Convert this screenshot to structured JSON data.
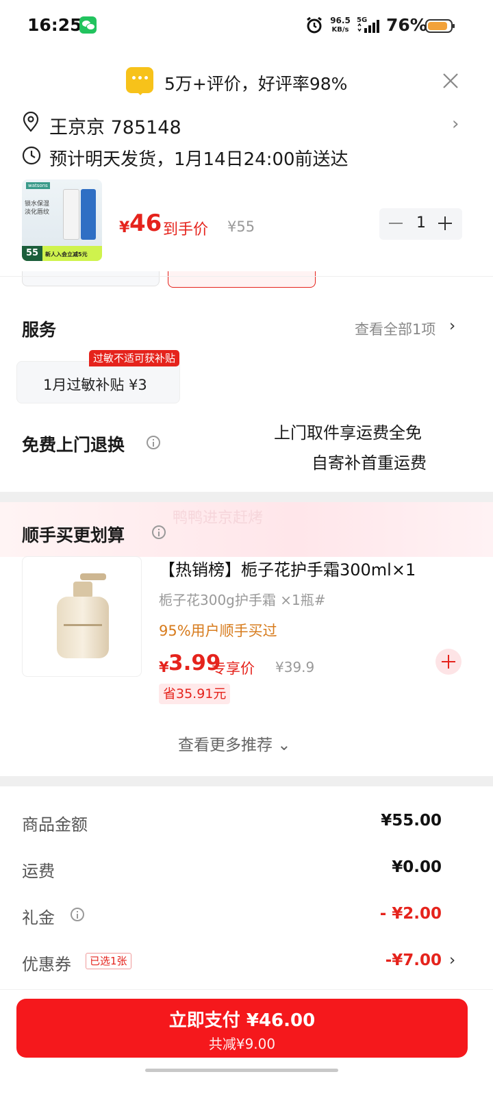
{
  "status_bar": {
    "time": "16:25",
    "net_speed_value": "96.5",
    "net_speed_unit": "KB/s",
    "network": "5G",
    "battery_percent": "76%"
  },
  "header": {
    "rating_text": "5万+评价，好评率98%"
  },
  "address": {
    "name_and_code": "王京京  785148",
    "delivery": "预计明天发货，1月14日24:00前送达"
  },
  "product": {
    "thumb_brand": "watsons",
    "thumb_text": "锁水保湿\n淡化唇纹",
    "thumb_badge_price": "55",
    "thumb_badge_note": "新人入会立减5元",
    "price_symbol": "¥",
    "price": "46",
    "price_label": "到手价",
    "original_price": "¥55",
    "quantity": "1"
  },
  "service": {
    "title": "服务",
    "view_all": "查看全部1项",
    "card_text": "1月过敏补贴  ¥3",
    "card_tag": "过敏不适可获补贴"
  },
  "returns": {
    "title": "免费上门退换",
    "line1": "上门取件享运费全免",
    "line2": "自寄补首重运费"
  },
  "recommend": {
    "watermark": "鸭鸭进京赶烤",
    "title": "顺手买更划算",
    "item": {
      "name": "【热销榜】栀子花护手霜300ml×1",
      "spec": "栀子花300g护手霜  ×1瓶#",
      "bought": "95%用户顺手买过",
      "price_symbol": "¥",
      "price": "3.99",
      "price_label": "专享价",
      "original_price": "¥39.9",
      "save": "省35.91元"
    },
    "more": "查看更多推荐 ⌄"
  },
  "summary": {
    "rows": [
      {
        "label": "商品金额",
        "value": "¥55.00"
      },
      {
        "label": "运费",
        "value": "¥0.00"
      },
      {
        "label": "礼金",
        "value": "- ¥2.00"
      },
      {
        "label": "优惠券",
        "value": "-¥7.00",
        "tag": "已选1张"
      }
    ]
  },
  "pay": {
    "main": "立即支付 ¥46.00",
    "sub": "共减¥9.00"
  },
  "colors": {
    "accent": "#e5231c",
    "pay_button": "#f5181c"
  }
}
